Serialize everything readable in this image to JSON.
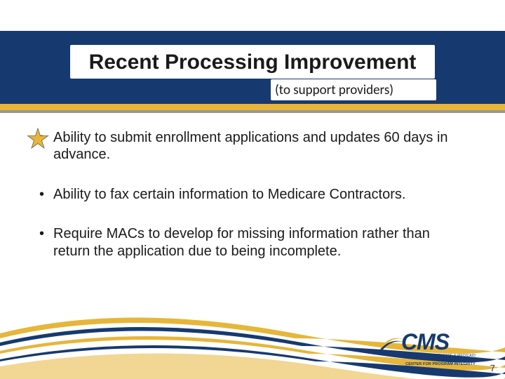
{
  "title": "Recent Processing Improvement",
  "subtitle": "(to support providers)",
  "bullets": [
    "Ability to submit enrollment applications and updates 60 days in advance.",
    "Ability to fax certain information to Medicare Contractors.",
    "Require MACs to develop for missing information rather than return the application due to being incomplete."
  ],
  "logo": {
    "main": "CMS",
    "sub1": "CENTERS FOR MEDICARE & MEDICAID SERVICES",
    "sub2": "CENTER FOR PROGRAM INTEGRITY"
  },
  "page_number": "7"
}
